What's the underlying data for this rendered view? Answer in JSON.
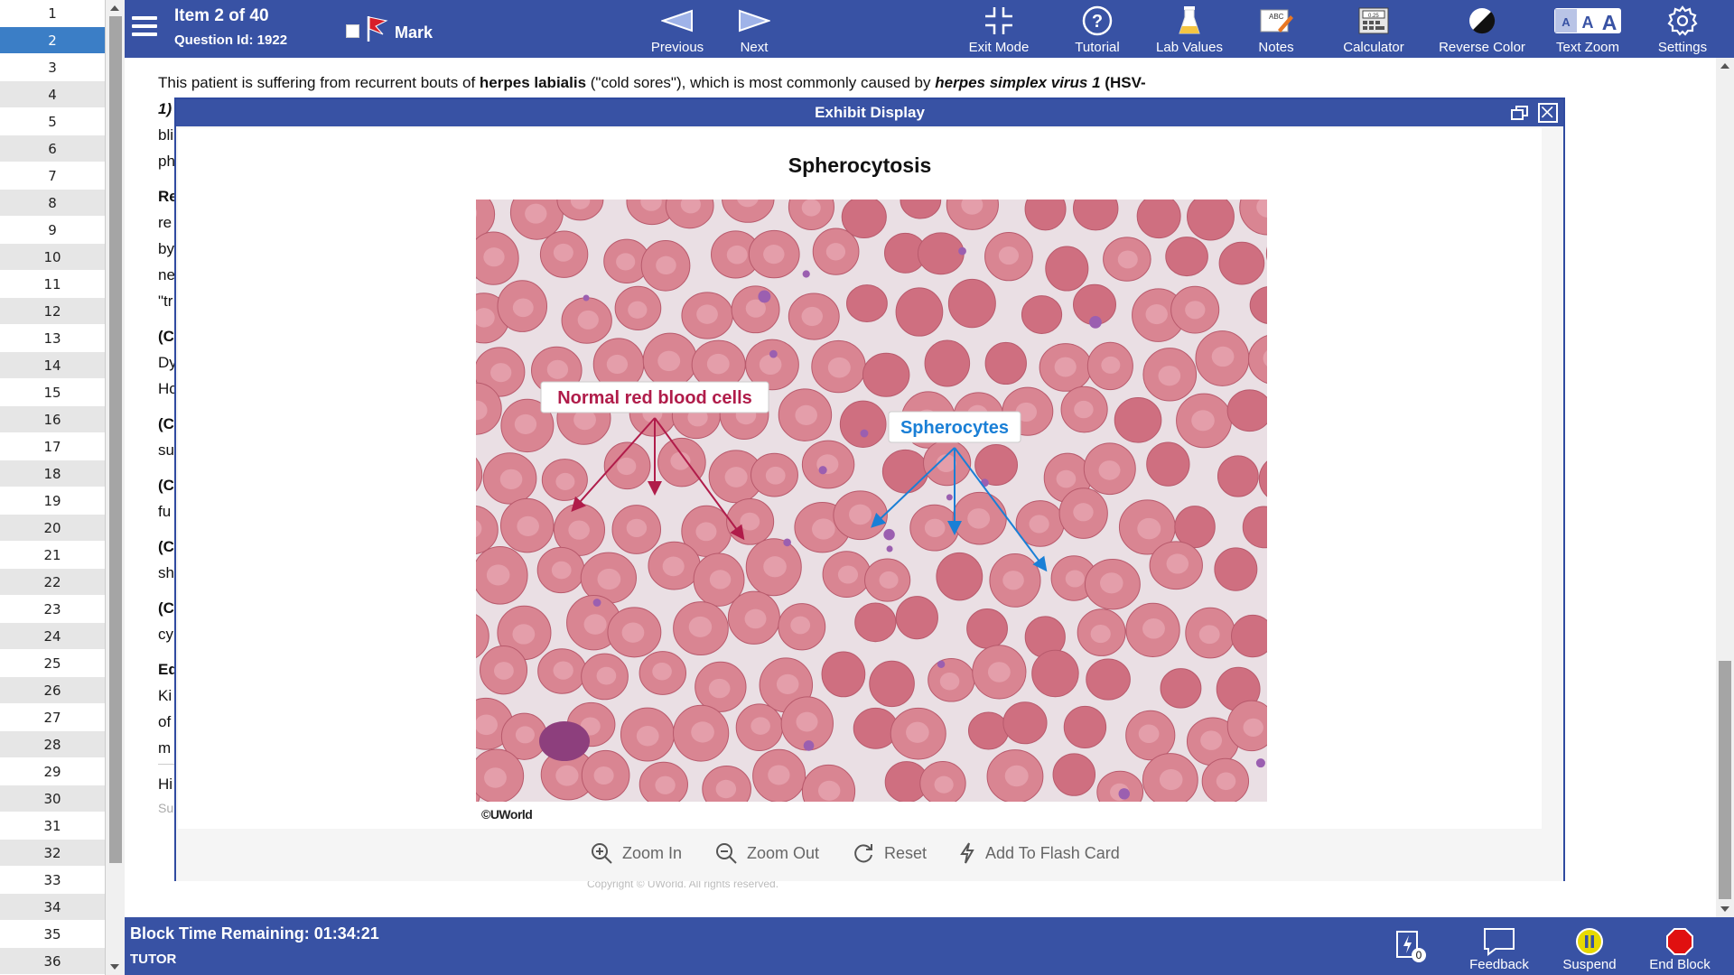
{
  "question_nav": {
    "items": [
      "1",
      "2",
      "3",
      "4",
      "5",
      "6",
      "7",
      "8",
      "9",
      "10",
      "11",
      "12",
      "13",
      "14",
      "15",
      "16",
      "17",
      "18",
      "19",
      "20",
      "21",
      "22",
      "23",
      "24",
      "25",
      "26",
      "27",
      "28",
      "29",
      "30",
      "31",
      "32",
      "33",
      "34",
      "35",
      "36"
    ],
    "active_index": 1
  },
  "topbar": {
    "item_title": "Item 2 of 40",
    "question_id": "Question Id: 1922",
    "mark_label": "Mark",
    "previous_label": "Previous",
    "next_label": "Next",
    "exit_mode_label": "Exit Mode",
    "tutorial_label": "Tutorial",
    "lab_values_label": "Lab Values",
    "notes_label": "Notes",
    "calculator_label": "Calculator",
    "reverse_color_label": "Reverse Color",
    "text_zoom_label": "Text Zoom",
    "settings_label": "Settings"
  },
  "explanation": {
    "line1_pre": "This patient is suffering from recurrent bouts of ",
    "line1_bold1": "herpes labialis",
    "line1_mid": " (\"cold sores\"), which is most commonly caused by ",
    "line1_bold2": "herpes simplex virus 1",
    "line1_bold3": " (HSV-",
    "line2_start": "1)",
    "fragments": [
      "bli",
      "ph",
      "Re",
      "re",
      "by",
      "ne",
      "\"tr",
      "(C",
      "Dy",
      "Hc",
      "(C",
      "su",
      "(C",
      "fu",
      "(C",
      "sh",
      "(C",
      "cy",
      "Ed",
      "Ki",
      "of",
      "m",
      "Hi",
      "Su"
    ]
  },
  "exhibit": {
    "header": "Exhibit Display",
    "title": "Spherocytosis",
    "label_normal": "Normal red blood cells",
    "label_sphero": "Spherocytes",
    "copyright_mark": "©UWorld",
    "zoom_in_label": "Zoom In",
    "zoom_out_label": "Zoom Out",
    "reset_label": "Reset",
    "flash_label": "Add To Flash Card",
    "faint_copyright": "Copyright © UWorld. All rights reserved."
  },
  "bottombar": {
    "time_remaining": "Block Time Remaining: 01:34:21",
    "mode": "TUTOR",
    "flash_count": "0",
    "feedback_label": "Feedback",
    "suspend_label": "Suspend",
    "end_block_label": "End Block"
  },
  "colors": {
    "bar_blue": "#3852a4",
    "active_blue": "#3b7ec6",
    "normal_label": "#b01c4a",
    "sphero_label": "#1a7fd6"
  }
}
